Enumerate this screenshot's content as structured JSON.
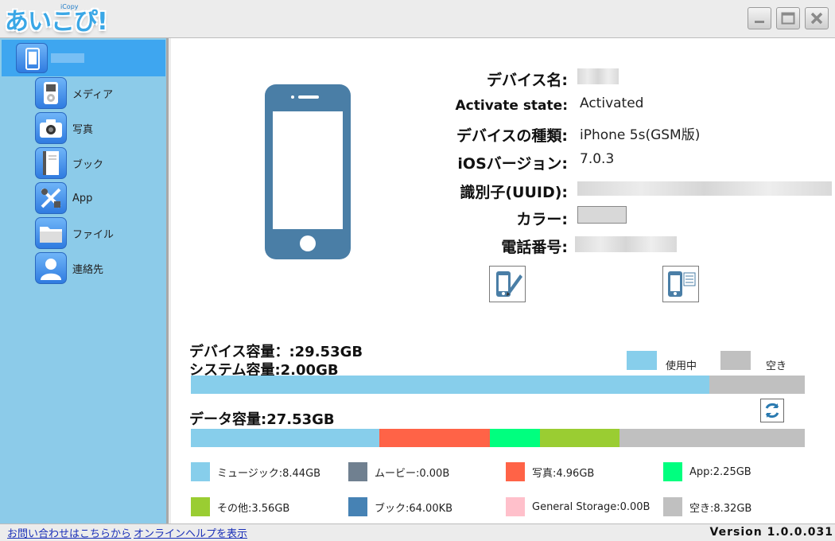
{
  "app": {
    "logo_text": "あいこぴ!",
    "logo_sub": "iCopy"
  },
  "sidebar": {
    "items": [
      {
        "label": "メディア",
        "icon": "media-player-icon"
      },
      {
        "label": "写真",
        "icon": "camera-icon"
      },
      {
        "label": "ブック",
        "icon": "book-icon"
      },
      {
        "label": "App",
        "icon": "app-tools-icon"
      },
      {
        "label": "ファイル",
        "icon": "folder-icon"
      },
      {
        "label": "連絡先",
        "icon": "contact-person-icon"
      }
    ]
  },
  "device_info": {
    "name_label": "デバイス名:",
    "activate_label": "Activate state:",
    "activate_value": "Activated",
    "type_label": "デバイスの種類:",
    "type_value": "iPhone 5s(GSM版)",
    "ios_label": "iOSバージョン:",
    "ios_value": "7.0.3",
    "uuid_label": "識別子(UUID):",
    "color_label": "カラー:",
    "phone_label": "電話番号:"
  },
  "capacity": {
    "device_capacity": "デバイス容量：:29.53GB",
    "system_capacity": "システム容量:2.00GB",
    "legend_used": "使用中",
    "legend_free": "空き",
    "system_used_fraction": 0.844,
    "data_capacity": "データ容量:27.53GB"
  },
  "data_breakdown": [
    {
      "label": "ミュージック:8.44GB",
      "color": "#87ceeb",
      "gb": 8.44
    },
    {
      "label": "ムービー:0.00B",
      "color": "#708090",
      "gb": 0
    },
    {
      "label": "写真:4.96GB",
      "color": "#ff6347",
      "gb": 4.96
    },
    {
      "label": "App:2.25GB",
      "color": "#00ff7f",
      "gb": 2.25
    },
    {
      "label": "その他:3.56GB",
      "color": "#9acd32",
      "gb": 3.56
    },
    {
      "label": "ブック:64.00KB",
      "color": "#4682b4",
      "gb": 6e-05
    },
    {
      "label": "General Storage:0.00B",
      "color": "#ffc0cb",
      "gb": 0
    },
    {
      "label": "空き:8.32GB",
      "color": "#c0c0c0",
      "gb": 8.32
    }
  ],
  "colors": {
    "used": "#87ceeb",
    "free": "#c0c0c0",
    "sidebar_bg": "#8ccbe9",
    "selected": "#3ea6f0"
  },
  "footer": {
    "contact_link": "お問い合わせはこちらから",
    "help_link": "オンラインヘルプを表示",
    "version": "Version 1.0.0.031"
  }
}
